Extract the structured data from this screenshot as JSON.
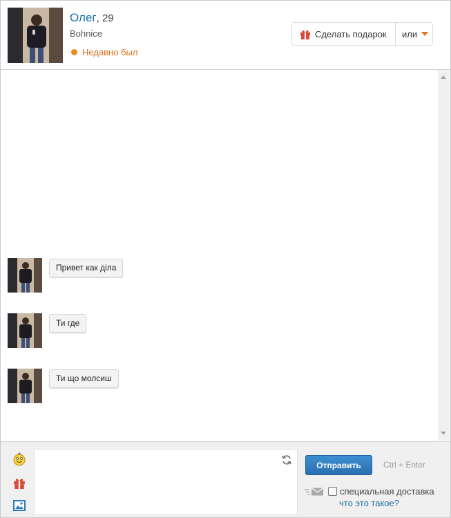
{
  "profile": {
    "name": "Олег",
    "age": ", 29",
    "city": "Bohnice",
    "status": "Недавно был",
    "status_color": "#f08a1e"
  },
  "actions": {
    "gift_label": "Сделать подарок",
    "more_label": "или",
    "accent_color": "#e0701a"
  },
  "messages": [
    {
      "text": "Привет как діла"
    },
    {
      "text": "Ти где"
    },
    {
      "text": "Ти що молсиш"
    }
  ],
  "composer": {
    "send_label": "Отправить",
    "shortcut_hint": "Ctrl + Enter",
    "delivery_label": "специальная доставка",
    "delivery_link": "что это такое?",
    "tools": [
      "smiley-icon",
      "gift-icon",
      "image-icon"
    ],
    "send_color": "#2a6fb0"
  }
}
